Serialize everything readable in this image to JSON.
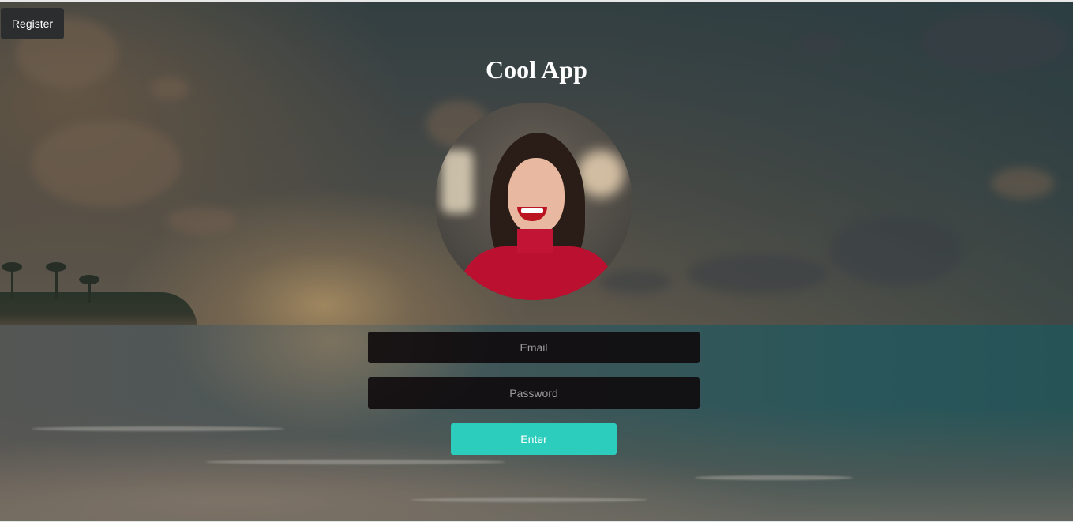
{
  "header": {
    "register_label": "Register",
    "title": "Cool App"
  },
  "form": {
    "email": {
      "placeholder": "Email",
      "value": ""
    },
    "password": {
      "placeholder": "Password",
      "value": ""
    },
    "submit_label": "Enter"
  },
  "colors": {
    "accent": "#2ccdbd",
    "register_button": "#2b2d2f",
    "field_background": "#0e080a",
    "title_text": "#ffffff"
  },
  "icons": {
    "avatar": "profile-photo"
  }
}
